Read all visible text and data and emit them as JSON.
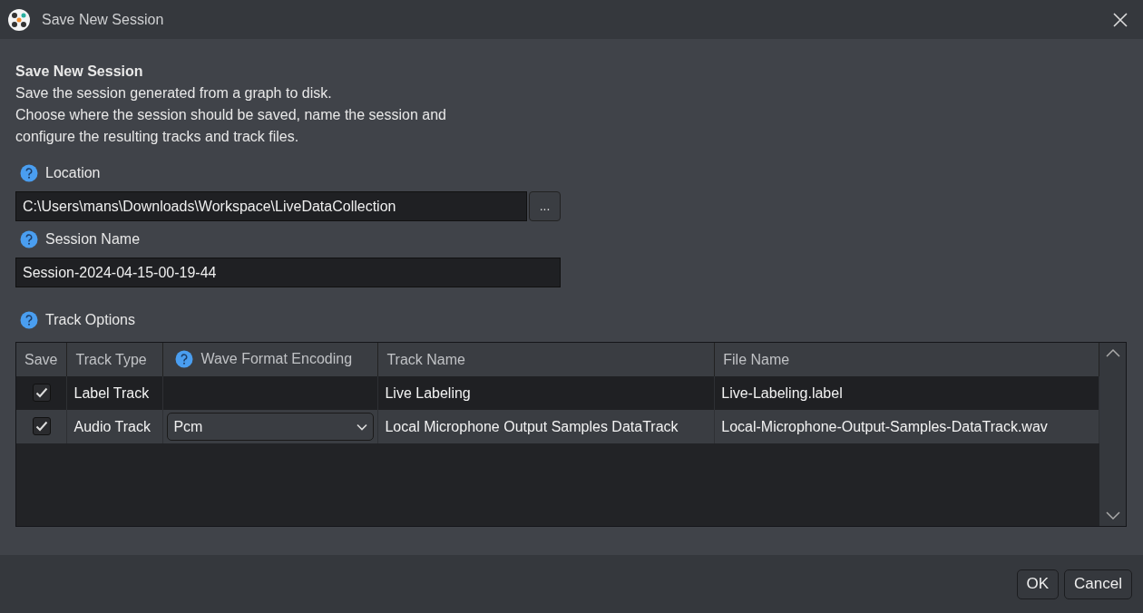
{
  "window": {
    "title": "Save New Session"
  },
  "header": {
    "title": "Save New Session",
    "lines": [
      "Save the session generated from a graph to disk.",
      "Choose where the session should be saved, name the session and",
      "configure the resulting tracks and track files."
    ]
  },
  "location": {
    "label": "Location",
    "value": "C:\\Users\\mans\\Downloads\\Workspace\\LiveDataCollection",
    "browse": "..."
  },
  "session_name": {
    "label": "Session Name",
    "value": "Session-2024-04-15-00-19-44"
  },
  "track_options": {
    "label": "Track Options",
    "columns": [
      {
        "label": "Save",
        "help": false
      },
      {
        "label": "Track Type",
        "help": false
      },
      {
        "label": "Wave Format Encoding",
        "help": true
      },
      {
        "label": "Track Name",
        "help": false
      },
      {
        "label": "File Name",
        "help": false
      }
    ],
    "rows": [
      {
        "save": true,
        "track_type": "Label Track",
        "track_name": "Live Labeling",
        "file_name": "Live-Labeling.label",
        "selected": false
      },
      {
        "save": true,
        "track_type": "Audio Track",
        "encoding": "Pcm",
        "track_name": "Local Microphone Output Samples DataTrack",
        "file_name": "Local-Microphone-Output-Samples-DataTrack.wav",
        "selected": true
      }
    ]
  },
  "buttons": [
    "OK",
    "Cancel"
  ]
}
